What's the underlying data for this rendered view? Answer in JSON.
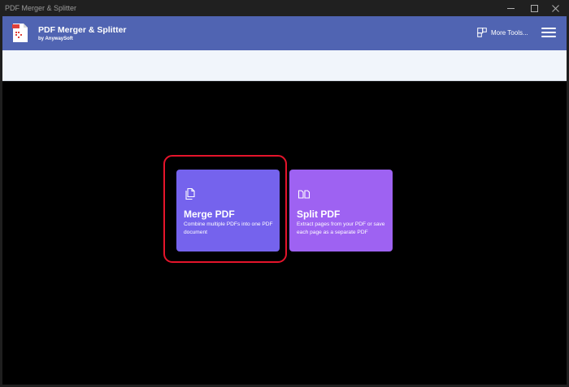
{
  "window": {
    "title": "PDF Merger & Splitter",
    "controls": [
      "minimize-icon",
      "maximize-icon",
      "close-icon"
    ]
  },
  "header": {
    "logo_icon": "pdf-app-logo",
    "app_name": "PDF Merger & Splitter",
    "app_subtitle": "by AnywaySoft",
    "more_tools_label": "More Tools...",
    "more_tools_icon": "tools-grid-icon",
    "menu_icon": "hamburger-menu-icon",
    "background_color": "#5064b2"
  },
  "cards": [
    {
      "title": "Merge PDF",
      "description": "Combine multiple PDFs into one PDF document",
      "icon": "merge-pdf-icon",
      "color": "#7563ed",
      "highlighted": true
    },
    {
      "title": "Split PDF",
      "description": "Extract pages from your PDF or save each page as a separate PDF",
      "icon": "split-pdf-icon",
      "color": "#9e62f2"
    }
  ],
  "highlight_color": "#e5142b"
}
